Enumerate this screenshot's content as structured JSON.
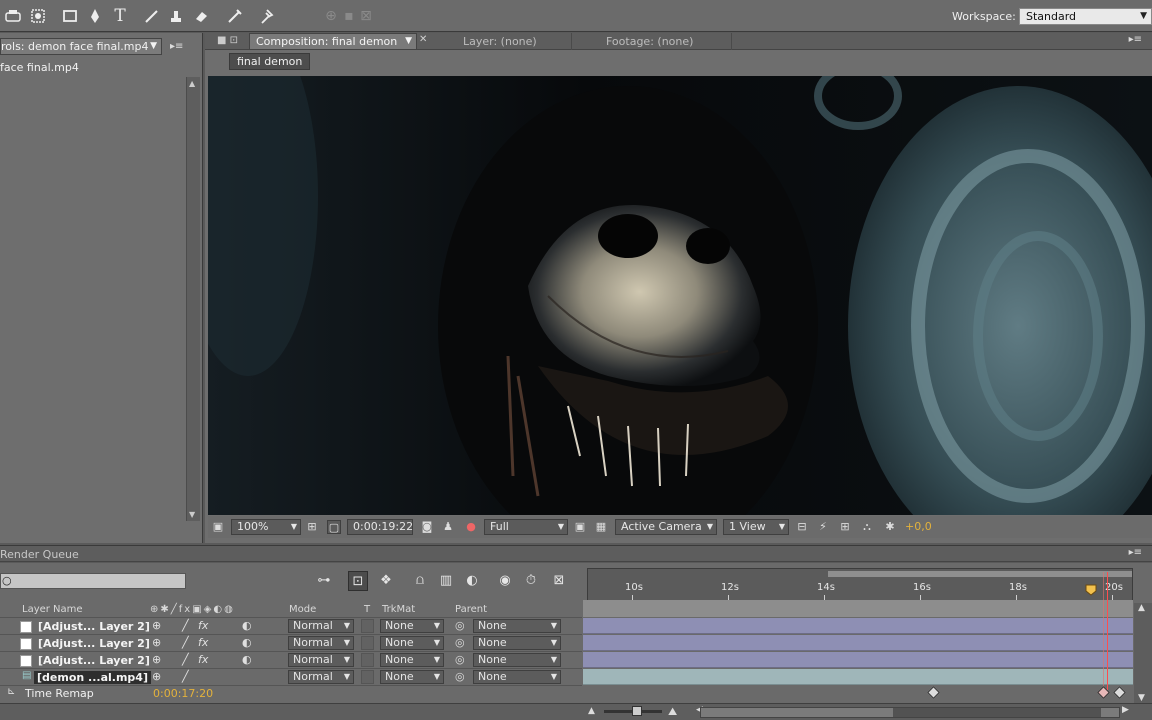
{
  "workspace": {
    "label": "Workspace:",
    "value": "Standard"
  },
  "left_panel": {
    "tab_label": "rols: demon face final.mp4",
    "file_item": "face final.mp4"
  },
  "comp_panel": {
    "tab_label": "Composition: final demon",
    "layer_tab": "Layer: (none)",
    "footage_tab": "Footage: (none)",
    "breadcrumb": "final demon"
  },
  "viewer_bar": {
    "zoom": "100%",
    "timecode": "0:00:19:22",
    "resolution": "Full",
    "camera": "Active Camera",
    "views": "1 View",
    "exposure": "+0,0"
  },
  "render_queue": {
    "label": "Render Queue"
  },
  "timeline": {
    "columns": {
      "layer_name": "Layer Name",
      "mode": "Mode",
      "t": "T",
      "trkmat": "TrkMat",
      "parent": "Parent"
    },
    "layers": [
      {
        "name": "[Adjust... Layer 2]",
        "mode": "Normal",
        "trkmat": "None",
        "parent": "None"
      },
      {
        "name": "[Adjust... Layer 2]",
        "mode": "Normal",
        "trkmat": "None",
        "parent": "None"
      },
      {
        "name": "[Adjust... Layer 2]",
        "mode": "Normal",
        "trkmat": "None",
        "parent": "None"
      },
      {
        "name": "[demon ...al.mp4]",
        "mode": "Normal",
        "trkmat": "None",
        "parent": "None"
      }
    ],
    "property": {
      "name": "Time Remap",
      "value": "0:00:17:20"
    },
    "ruler_labels": [
      "10s",
      "12s",
      "14s",
      "16s",
      "18s",
      "20s"
    ]
  },
  "colors": {
    "accent_timecode": "#e3b23c",
    "cti": "#ff4d4d",
    "adjustment_bar": "#8e8fb4",
    "media_bar": "#9fb6b9"
  }
}
